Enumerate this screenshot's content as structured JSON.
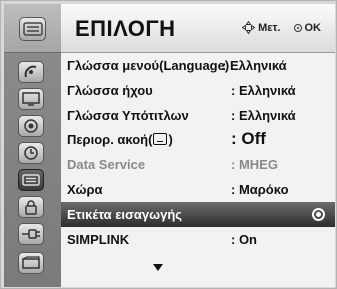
{
  "header": {
    "title": "ΕΠΙΛΟΓΗ",
    "move_hint": "Μετ.",
    "ok_hint": "OK"
  },
  "menu": [
    {
      "label": "Γλώσσα μενού(Language)",
      "value": ": Ελληνικά",
      "state": "normal"
    },
    {
      "label": "Γλώσσα ήχου",
      "value": ": Ελληνικά",
      "state": "normal"
    },
    {
      "label": "Γλώσσα Υπότιτλων",
      "value": ": Ελληνικά",
      "state": "normal"
    },
    {
      "label_prefix": "Περιορ. ακοή(",
      "label_suffix": ")",
      "value": ": Off",
      "state": "normal"
    },
    {
      "label": "Data Service",
      "value": ": MHEG",
      "state": "disabled"
    },
    {
      "label": "Χώρα",
      "value": ": Μαρόκο",
      "state": "normal"
    },
    {
      "label": "Ετικέτα εισαγωγής",
      "value": "",
      "state": "selected"
    },
    {
      "label": "SIMPLINK",
      "value": ": On",
      "state": "normal"
    }
  ],
  "sidebar_icons": [
    "settings-header-icon",
    "satellite-dish-icon",
    "picture-icon",
    "audio-icon",
    "clock-icon",
    "option-icon",
    "lock-icon",
    "input-icon",
    "usb-icon"
  ],
  "colors": {
    "selected_row": "#3a3a3a",
    "disabled_text": "#8a8a8a"
  }
}
